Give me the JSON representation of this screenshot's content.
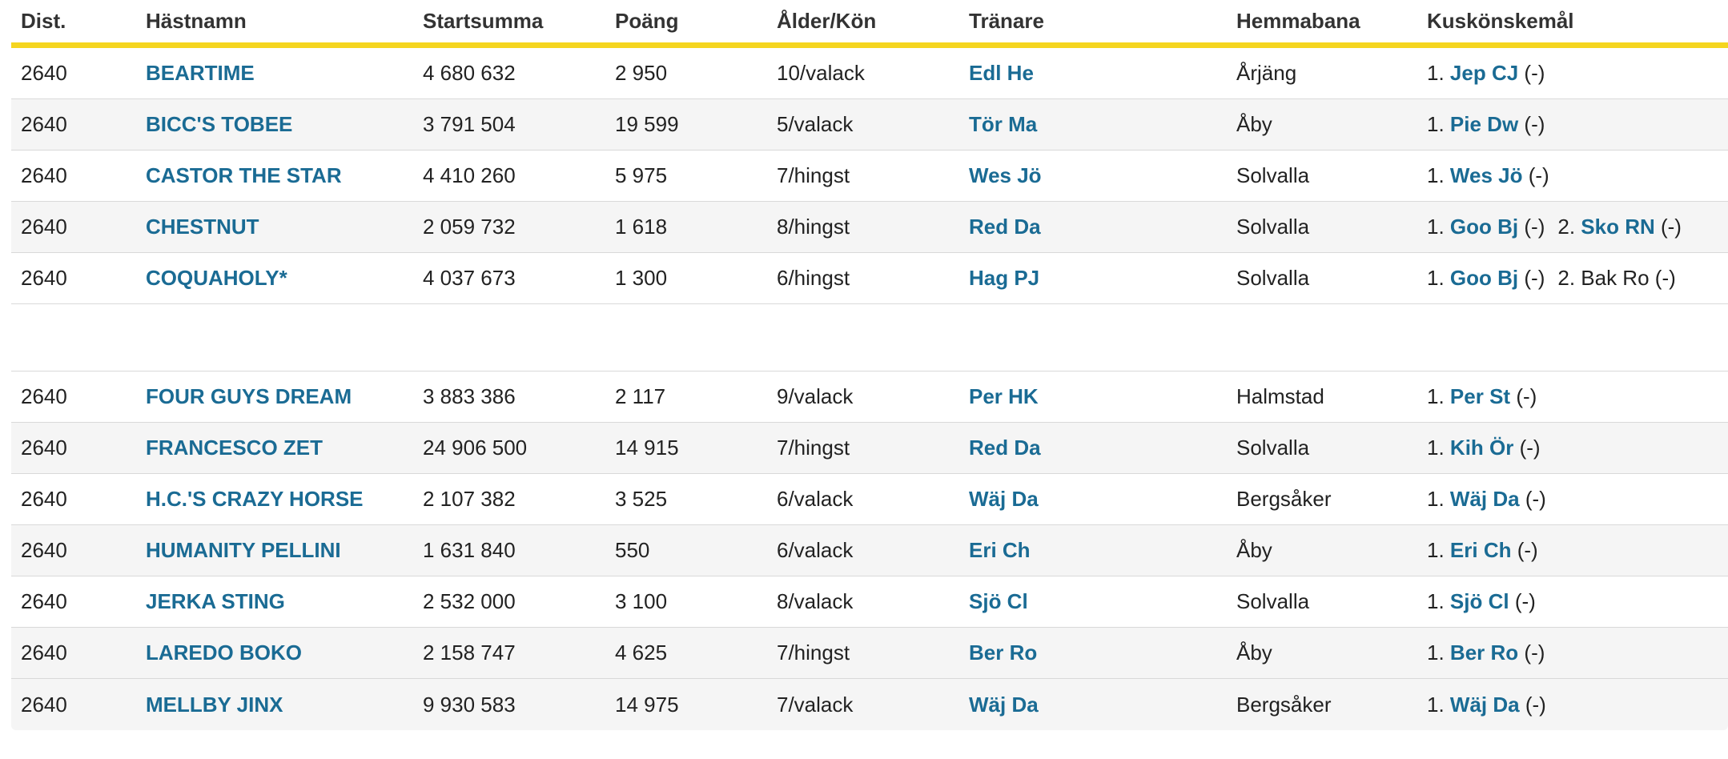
{
  "headers": {
    "dist": "Dist.",
    "name": "Hästnamn",
    "sum": "Startsumma",
    "points": "Poäng",
    "age": "Ålder/Kön",
    "trainer": "Tränare",
    "home": "Hemmabana",
    "drivers": "Kuskönskemål"
  },
  "rows": [
    {
      "dist": "2640",
      "name": "BEARTIME",
      "sum": "4 680 632",
      "points": "2 950",
      "age": "10/valack",
      "trainer": "Edl He",
      "home": "Årjäng",
      "drivers": [
        {
          "num": "1.",
          "name": "Jep CJ",
          "link": true,
          "note": "(-)"
        }
      ]
    },
    {
      "dist": "2640",
      "name": "BICC'S TOBEE",
      "sum": "3 791 504",
      "points": "19 599",
      "age": "5/valack",
      "trainer": "Tör Ma",
      "home": "Åby",
      "drivers": [
        {
          "num": "1.",
          "name": "Pie Dw",
          "link": true,
          "note": "(-)"
        }
      ]
    },
    {
      "dist": "2640",
      "name": "CASTOR THE STAR",
      "sum": "4 410 260",
      "points": "5 975",
      "age": "7/hingst",
      "trainer": "Wes Jö",
      "home": "Solvalla",
      "drivers": [
        {
          "num": "1.",
          "name": "Wes Jö",
          "link": true,
          "note": "(-)"
        }
      ]
    },
    {
      "dist": "2640",
      "name": "CHESTNUT",
      "sum": "2 059 732",
      "points": "1 618",
      "age": "8/hingst",
      "trainer": "Red Da",
      "home": "Solvalla",
      "drivers": [
        {
          "num": "1.",
          "name": "Goo Bj",
          "link": true,
          "note": "(-)"
        },
        {
          "num": "2.",
          "name": "Sko RN",
          "link": true,
          "note": "(-)"
        }
      ]
    },
    {
      "dist": "2640",
      "name": "COQUAHOLY*",
      "sum": "4 037 673",
      "points": "1 300",
      "age": "6/hingst",
      "trainer": "Hag PJ",
      "home": "Solvalla",
      "drivers": [
        {
          "num": "1.",
          "name": "Goo Bj",
          "link": true,
          "note": "(-)"
        },
        {
          "num": "2.",
          "name": "Bak Ro",
          "link": false,
          "note": "(-)"
        }
      ]
    },
    {
      "dist": "2640",
      "name": "FOUR GUYS DREAM",
      "sum": "3 883 386",
      "points": "2 117",
      "age": "9/valack",
      "trainer": "Per HK",
      "home": "Halmstad",
      "drivers": [
        {
          "num": "1.",
          "name": "Per St",
          "link": true,
          "note": "(-)"
        }
      ]
    },
    {
      "dist": "2640",
      "name": "FRANCESCO ZET",
      "sum": "24 906 500",
      "points": "14 915",
      "age": "7/hingst",
      "trainer": "Red Da",
      "home": "Solvalla",
      "drivers": [
        {
          "num": "1.",
          "name": "Kih Ör",
          "link": true,
          "note": "(-)"
        }
      ]
    },
    {
      "dist": "2640",
      "name": "H.C.'S CRAZY HORSE",
      "sum": "2 107 382",
      "points": "3 525",
      "age": "6/valack",
      "trainer": "Wäj Da",
      "home": "Bergsåker",
      "drivers": [
        {
          "num": "1.",
          "name": "Wäj Da",
          "link": true,
          "note": "(-)"
        }
      ]
    },
    {
      "dist": "2640",
      "name": "HUMANITY PELLINI",
      "sum": "1 631 840",
      "points": "550",
      "age": "6/valack",
      "trainer": "Eri Ch",
      "home": "Åby",
      "drivers": [
        {
          "num": "1.",
          "name": "Eri Ch",
          "link": true,
          "note": "(-)"
        }
      ]
    },
    {
      "dist": "2640",
      "name": "JERKA STING",
      "sum": "2 532 000",
      "points": "3 100",
      "age": "8/valack",
      "trainer": "Sjö Cl",
      "home": "Solvalla",
      "drivers": [
        {
          "num": "1.",
          "name": "Sjö Cl",
          "link": true,
          "note": "(-)"
        }
      ]
    },
    {
      "dist": "2640",
      "name": "LAREDO BOKO",
      "sum": "2 158 747",
      "points": "4 625",
      "age": "7/hingst",
      "trainer": "Ber Ro",
      "home": "Åby",
      "drivers": [
        {
          "num": "1.",
          "name": "Ber Ro",
          "link": true,
          "note": "(-)"
        }
      ]
    },
    {
      "dist": "2640",
      "name": "MELLBY JINX",
      "sum": "9 930 583",
      "points": "14 975",
      "age": "7/valack",
      "trainer": "Wäj Da",
      "home": "Bergsåker",
      "drivers": [
        {
          "num": "1.",
          "name": "Wäj Da",
          "link": true,
          "note": "(-)"
        }
      ]
    }
  ],
  "colors": {
    "link": "#1a6b94",
    "header_rule": "#f5d51f",
    "row_alt": "#f5f5f5"
  }
}
